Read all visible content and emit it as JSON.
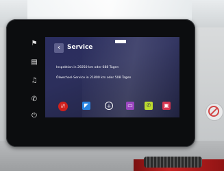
{
  "screen": {
    "title": "Service",
    "back_icon": "back-arrow-icon",
    "lines": [
      "Inspektion in 29250 km oder 688 Tagen",
      "Ölwechsel-Service in 21800 km oder 508 Tagen"
    ]
  },
  "dock": [
    {
      "name": "home-icon",
      "color": "#d0201c",
      "glyph": "///"
    },
    {
      "name": "navigation-icon",
      "color": "#1f7fe0",
      "glyph": "◤"
    },
    {
      "name": "add-icon",
      "color": "#2b2e60",
      "glyph": "+"
    },
    {
      "name": "media-icon",
      "color": "#8e2fb8",
      "glyph": "▭"
    },
    {
      "name": "phone-icon",
      "color": "#b7d81f",
      "glyph": "✆"
    },
    {
      "name": "car-icon",
      "color": "#d42e4a",
      "glyph": "▣"
    }
  ],
  "side_buttons": [
    "flag-icon",
    "car-settings-icon",
    "music-note-icon",
    "phone-handset-icon",
    "power-icon"
  ],
  "colors": {
    "screen_bg": "#2b2e60",
    "accent_red": "#c52121"
  }
}
